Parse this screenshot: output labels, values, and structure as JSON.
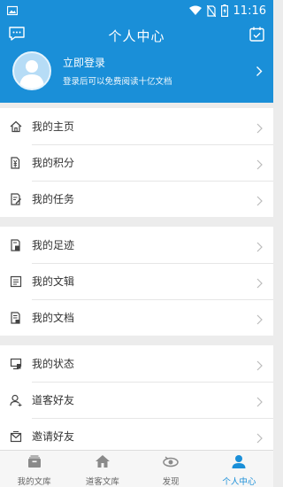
{
  "status_bar": {
    "time": "11:16",
    "icons": [
      "image-notification-icon",
      "wifi-icon",
      "no-sim-icon",
      "battery-icon"
    ]
  },
  "header": {
    "title": "个人中心",
    "left_icon": "message-icon",
    "right_icon": "calendar-checkin-icon",
    "background_color": "#1a8fd8"
  },
  "login": {
    "title": "立即登录",
    "subtitle": "登录后可以免费阅读十亿文档"
  },
  "menu_groups": [
    [
      {
        "label": "我的主页",
        "icon": "home-icon"
      },
      {
        "label": "我的积分",
        "icon": "points-icon"
      },
      {
        "label": "我的任务",
        "icon": "task-icon"
      }
    ],
    [
      {
        "label": "我的足迹",
        "icon": "footprint-icon"
      },
      {
        "label": "我的文辑",
        "icon": "collection-icon"
      },
      {
        "label": "我的文档",
        "icon": "document-icon"
      }
    ],
    [
      {
        "label": "我的状态",
        "icon": "status-icon"
      },
      {
        "label": "道客好友",
        "icon": "friends-icon"
      },
      {
        "label": "邀请好友",
        "icon": "invite-icon"
      }
    ]
  ],
  "tabs": [
    {
      "label": "我的文库",
      "icon": "library-icon",
      "active": false
    },
    {
      "label": "道客文库",
      "icon": "house-icon",
      "active": false
    },
    {
      "label": "发现",
      "icon": "discover-icon",
      "active": false
    },
    {
      "label": "个人中心",
      "icon": "person-icon",
      "active": true
    }
  ]
}
